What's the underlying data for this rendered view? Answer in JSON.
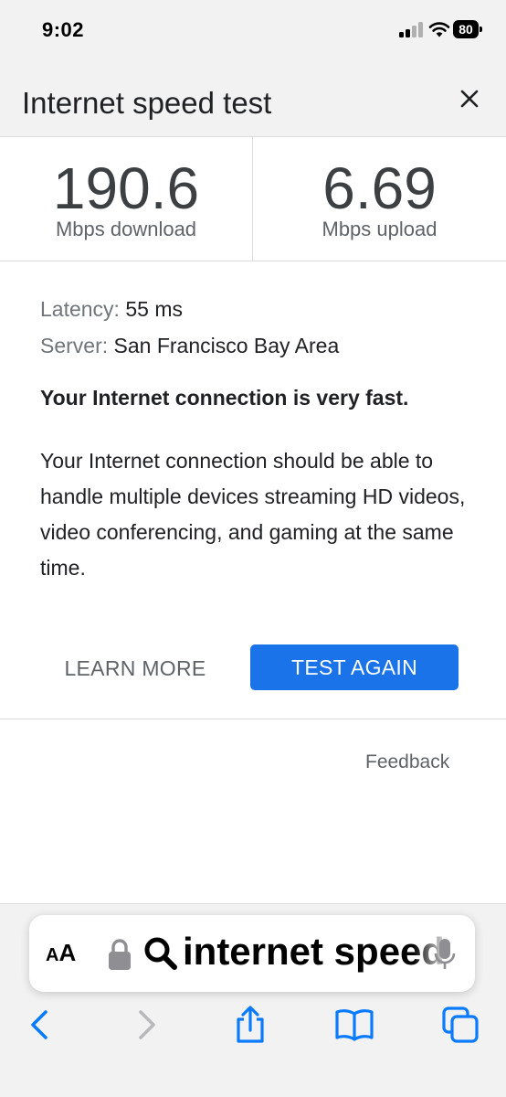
{
  "status_bar": {
    "time": "9:02",
    "battery": "80"
  },
  "header": {
    "title": "Internet speed test"
  },
  "speeds": {
    "download_value": "190.6",
    "download_unit": "Mbps download",
    "upload_value": "6.69",
    "upload_unit": "Mbps upload"
  },
  "details": {
    "latency_label": "Latency:",
    "latency_value": "55 ms",
    "server_label": "Server:",
    "server_value": "San Francisco Bay Area"
  },
  "verdict": "Your Internet connection is very fast.",
  "description": "Your Internet connection should be able to handle multiple devices streaming HD videos, video conferencing, and gaming at the same time.",
  "buttons": {
    "learn_more": "LEARN MORE",
    "test_again": "TEST AGAIN"
  },
  "feedback": "Feedback",
  "safari": {
    "aa_big": "A",
    "aa_small": "A",
    "url_text": "internet speed test"
  },
  "colors": {
    "accent": "#1a73e8",
    "text": "#202124",
    "muted": "#5f6368",
    "bar_bg": "#f2f2f2",
    "ios_blue": "#0a7aff"
  },
  "icons": [
    "cellular-signal-icon",
    "wifi-icon",
    "battery-icon",
    "close-icon",
    "lock-icon",
    "search-icon",
    "microphone-icon",
    "back-icon",
    "forward-icon",
    "share-icon",
    "bookmarks-icon",
    "tabs-icon"
  ]
}
